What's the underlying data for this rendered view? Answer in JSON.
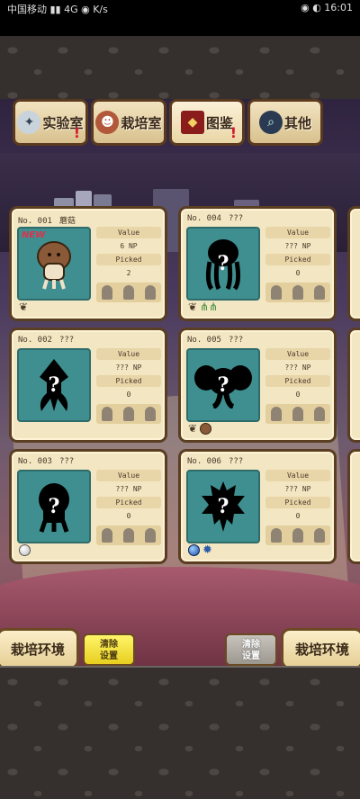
{
  "status_bar": {
    "left": "中国移动 ▮▮ 4G ◉ K/s",
    "right": "◉ ◐ 16:01"
  },
  "tabs": [
    {
      "label": "实验室",
      "icon": "microscope-icon",
      "alert": true,
      "active": false
    },
    {
      "label": "栽培室",
      "icon": "character-icon",
      "alert": false,
      "active": false
    },
    {
      "label": "图鉴",
      "icon": "book-icon",
      "alert": true,
      "active": true
    },
    {
      "label": "其他",
      "icon": "magnifier-icon",
      "alert": false,
      "active": false
    }
  ],
  "cards": [
    {
      "no": "No. 001",
      "name": "蘑菇",
      "new": true,
      "new_label": "NEW",
      "value_label": "Value",
      "value": "6 NP",
      "picked_label": "Picked",
      "picked": "2",
      "silhouette": "mushroom",
      "items": [
        "sprout-icon"
      ]
    },
    {
      "no": "No. 004",
      "name": "???",
      "new": false,
      "value_label": "Value",
      "value": "??? NP",
      "picked_label": "Picked",
      "picked": "0",
      "silhouette": "jelly",
      "items": [
        "sprout-icon",
        "grass-icon"
      ]
    },
    {
      "no": "No. 002",
      "name": "???",
      "new": false,
      "value_label": "Value",
      "value": "??? NP",
      "picked_label": "Picked",
      "picked": "0",
      "silhouette": "squid",
      "items": []
    },
    {
      "no": "No. 005",
      "name": "???",
      "new": false,
      "value_label": "Value",
      "value": "??? NP",
      "picked_label": "Picked",
      "picked": "0",
      "silhouette": "elephant",
      "items": [
        "sprout-icon",
        "ball-icon"
      ]
    },
    {
      "no": "No. 003",
      "name": "???",
      "new": false,
      "value_label": "Value",
      "value": "??? NP",
      "picked_label": "Picked",
      "picked": "0",
      "silhouette": "blob",
      "items": [
        "white-orb-icon"
      ]
    },
    {
      "no": "No. 006",
      "name": "???",
      "new": false,
      "value_label": "Value",
      "value": "??? NP",
      "picked_label": "Picked",
      "picked": "0",
      "silhouette": "spiky",
      "items": [
        "blue-orb-icon",
        "gear-icon"
      ]
    }
  ],
  "bottom": {
    "left_env": "栽培环境",
    "left_clear": "清除\n设置",
    "right_clear": "清除\n设置",
    "right_env": "栽培环境"
  },
  "colors": {
    "card_bg": "#f3e6c2",
    "portrait_bg": "#3f8f90",
    "accent_red": "#d81a2a",
    "clear_yellow": "#f2e23a"
  }
}
